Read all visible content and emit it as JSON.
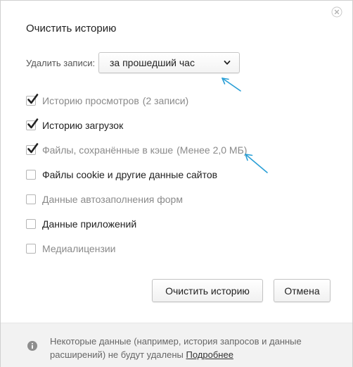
{
  "dialog": {
    "title": "Очистить историю"
  },
  "delete_records": {
    "label": "Удалить записи:",
    "selected_value": "за прошедший час"
  },
  "options": [
    {
      "label": "Историю просмотров",
      "extra": "(2 записи)",
      "checked": true,
      "muted": true
    },
    {
      "label": "Историю загрузок",
      "extra": "",
      "checked": true,
      "muted": false
    },
    {
      "label": "Файлы, сохранённые в кэше",
      "extra": "(Менее 2,0 МБ)",
      "checked": true,
      "muted": true
    },
    {
      "label": "Файлы cookie и другие данные сайтов",
      "extra": "",
      "checked": false,
      "muted": false
    },
    {
      "label": "Данные автозаполнения форм",
      "extra": "",
      "checked": false,
      "muted": true
    },
    {
      "label": "Данные приложений",
      "extra": "",
      "checked": false,
      "muted": false
    },
    {
      "label": "Медиалицензии",
      "extra": "",
      "checked": false,
      "muted": true
    }
  ],
  "buttons": {
    "clear_label": "Очистить историю",
    "cancel_label": "Отмена"
  },
  "footer": {
    "text": "Некоторые данные (например, история запросов и данные расширений) не будут удалены",
    "link": "Подробнее"
  },
  "colors": {
    "checkmark": "#222222",
    "annotation_arrow": "#2a9fd6",
    "footer_bg": "#f2f2f2"
  },
  "icons": {
    "close": "close-icon",
    "dropdown": "chevron-down-icon",
    "info": "info-icon",
    "check": "checkmark-icon"
  }
}
